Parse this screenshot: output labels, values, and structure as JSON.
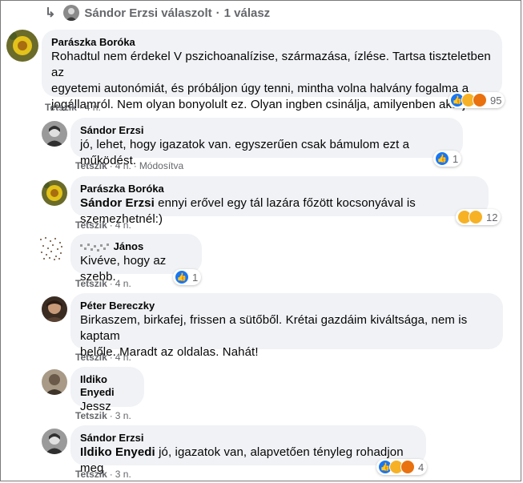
{
  "header": {
    "name": "Sándor Erzsi válaszolt",
    "sep": "·",
    "count": "1 válasz"
  },
  "actions_label": "Tetszik",
  "comments": [
    {
      "author": "Parászka Boróka",
      "lines": [
        "Rohadtul nem érdekel V pszichoanalízise, származása, ízlése. Tartsa tiszteletben az",
        "egyetemi autonómiát, és próbáljon úgy tenni, mintha volna halvány fogalma a",
        "jogállamról. Nem olyan bonyolult ez. Olyan ingben csinálja, amilyenben akarja"
      ],
      "time": "4 n.",
      "reaction_count": "95"
    },
    {
      "author": "Sándor Erzsi",
      "lines": [
        "jó, lehet, hogy igazatok van. egyszerűen csak bámulom ezt a működést."
      ],
      "time": "4 n.",
      "edited": "Módosítva",
      "reaction_count": "1"
    },
    {
      "author": "Parászka Boróka",
      "mention": "Sándor Erzsi",
      "rest": " ennyi erővel egy tál lazára főzött kocsonyával is szemezhetnél:)",
      "time": "4 n.",
      "reaction_count": "12"
    },
    {
      "author": "János",
      "lines": [
        "Kivéve, hogy az szebb."
      ],
      "time": "4 n.",
      "reaction_count": "1"
    },
    {
      "author": "Péter Bereczky",
      "lines": [
        "Birkaszem, birkafej, frissen a sütőből. Krétai gazdáim kiváltsága, nem is kaptam",
        "belőle. Maradt az oldalas. Nahát!"
      ],
      "time": "4 n."
    },
    {
      "author": "Ildiko Enyedi",
      "lines": [
        "Jessz"
      ],
      "time": "3 n."
    },
    {
      "author": "Sándor Erzsi",
      "mention": "Ildiko Enyedi",
      "rest": " jó, igazatok van, alapvetően tényleg rohadjon meg",
      "time": "3 n.",
      "reaction_count": "4"
    }
  ]
}
